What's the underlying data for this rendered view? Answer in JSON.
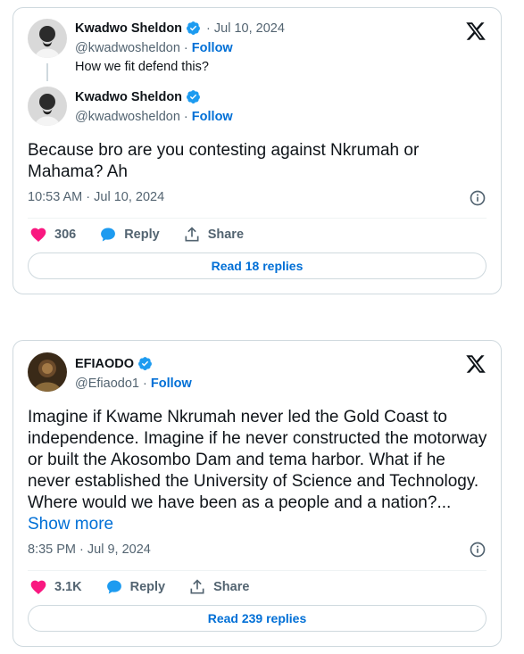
{
  "tweets": [
    {
      "quoted": {
        "author_name": "Kwadwo Sheldon",
        "date": "Jul 10, 2024",
        "handle": "@kwadwosheldon",
        "follow_label": "Follow",
        "text": "How we fit defend this?"
      },
      "author_name": "Kwadwo Sheldon",
      "handle": "@kwadwosheldon",
      "follow_label": "Follow",
      "text": "Because bro are you contesting against Nkrumah or Mahama? Ah",
      "show_more": "",
      "timestamp": "10:53 AM · Jul 10, 2024",
      "likes": "306",
      "reply_label": "Reply",
      "share_label": "Share",
      "read_replies": "Read 18 replies",
      "separator": " · "
    },
    {
      "author_name": "EFIAODO",
      "handle": "@Efiaodo1",
      "follow_label": "Follow",
      "text": "Imagine if Kwame Nkrumah never led the Gold Coast to independence. Imagine if he never constructed the motorway or built the Akosombo Dam and tema harbor. What if he never established the University of Science and Technology. Where would we have been as a people and a nation?...",
      "show_more": "Show more",
      "timestamp": "8:35 PM · Jul 9, 2024",
      "likes": "3.1K",
      "reply_label": "Reply",
      "share_label": "Share",
      "read_replies": "Read 239 replies",
      "separator": " · "
    }
  ],
  "colors": {
    "like": "#f91880",
    "reply": "#1d9bf0",
    "link": "#006fd6",
    "verified": "#1d9bf0",
    "muted": "#536471"
  },
  "icons": [
    "verified-badge-icon",
    "x-logo-icon",
    "heart-icon",
    "reply-bubble-icon",
    "share-upload-icon",
    "info-icon"
  ]
}
